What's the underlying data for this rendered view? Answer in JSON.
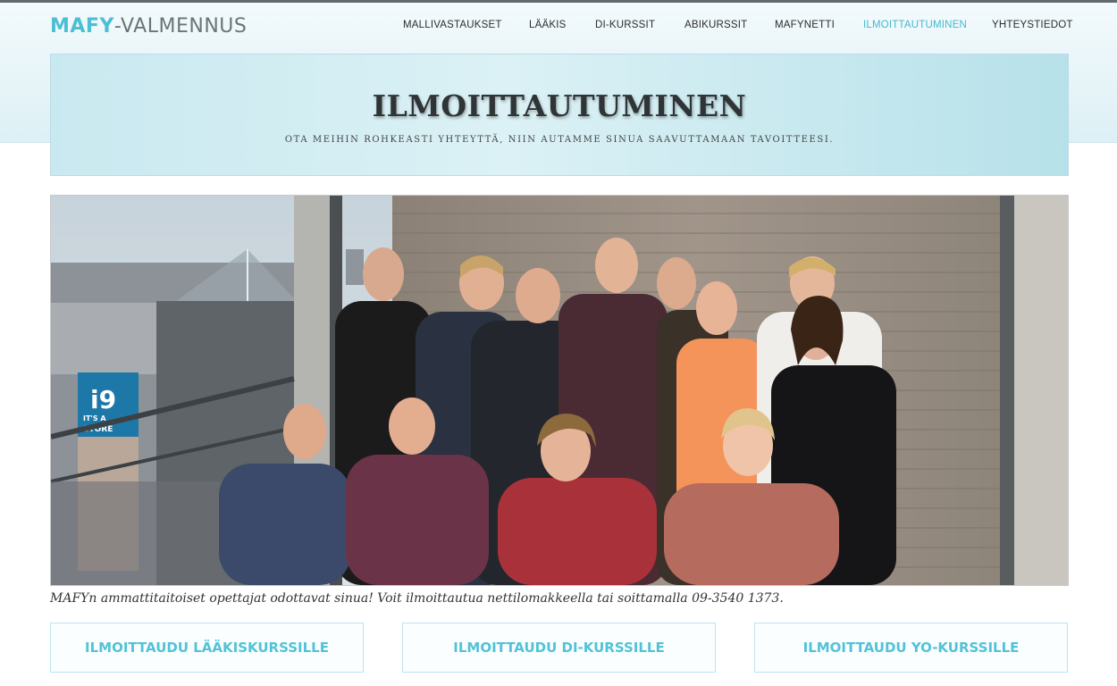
{
  "header": {
    "logo_brand": "MAFY",
    "logo_rest": "-VALMENNUS",
    "nav": [
      {
        "label": "MALLIVASTAUKSET"
      },
      {
        "label": "LÄÄKIS"
      },
      {
        "label": "DI-KURSSIT"
      },
      {
        "label": "ABIKURSSIT"
      },
      {
        "label": "MAFYNETTI"
      },
      {
        "label": "ILMOITTAUTUMINEN",
        "active": true
      },
      {
        "label": "YHTEYSTIEDOT"
      }
    ]
  },
  "hero": {
    "title": "ILMOITTAUTUMINEN",
    "subtitle": "OTA MEIHIN ROHKEASTI YHTEYTTÄ, NIIN AUTAMME SINUA SAAVUTTAMAAN TAVOITTEESI."
  },
  "photo": {
    "sign_text": "i9",
    "sign_small": "IT'S A",
    "sign_small2": "STORE"
  },
  "caption": "MAFYn ammattitaitoiset opettajat odottavat sinua! Voit ilmoittautua nettilomakkeella tai soittamalla 09-3540 1373.",
  "cta": [
    {
      "label": "ILMOITTAUDU LÄÄKISKURSSILLE"
    },
    {
      "label": "ILMOITTAUDU DI-KURSSILLE"
    },
    {
      "label": "ILMOITTAUDU YO-KURSSILLE"
    }
  ],
  "colors": {
    "accent": "#43b9cf",
    "hero_bg": "#c9e9f0",
    "text_dark": "#2d2d2d"
  }
}
